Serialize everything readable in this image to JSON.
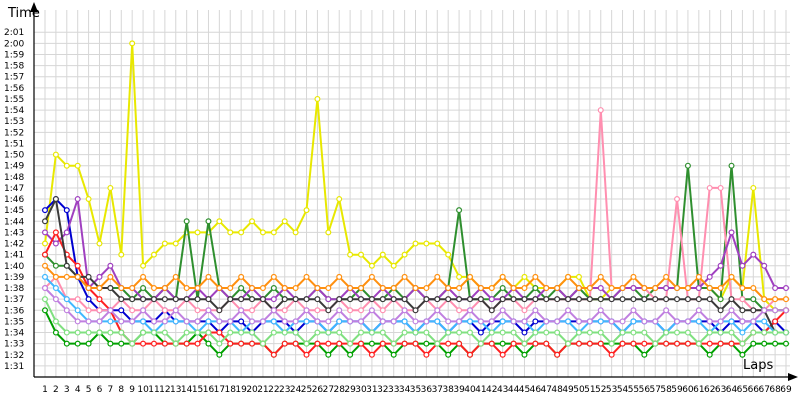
{
  "chart_data": {
    "type": "line",
    "title": "",
    "xlabel": "Laps",
    "ylabel": "Time",
    "grid": true,
    "legend": "none",
    "xlim": [
      1,
      69
    ],
    "ylim": [
      "1:30",
      "2:03"
    ],
    "x_ticks": [
      "1",
      "2",
      "3",
      "4",
      "5",
      "6",
      "7",
      "8",
      "9",
      "10",
      "11",
      "12",
      "13",
      "14",
      "15",
      "16",
      "17",
      "18",
      "19",
      "20",
      "21",
      "22",
      "23",
      "24",
      "25",
      "26",
      "27",
      "28",
      "29",
      "30",
      "31",
      "32",
      "33",
      "34",
      "35",
      "36",
      "37",
      "38",
      "39",
      "40",
      "41",
      "42",
      "43",
      "44",
      "45",
      "46",
      "47",
      "48",
      "49",
      "50",
      "51",
      "52",
      "53",
      "54",
      "55",
      "56",
      "57",
      "58",
      "59",
      "60",
      "61",
      "62",
      "63",
      "64",
      "65",
      "66",
      "67",
      "68",
      "69"
    ],
    "y_ticks": [
      "1:31",
      "1:32",
      "1:33",
      "1:34",
      "1:35",
      "1:36",
      "1:37",
      "1:38",
      "1:39",
      "1:40",
      "1:41",
      "1:42",
      "1:43",
      "1:44",
      "1:45",
      "1:46",
      "1:47",
      "1:48",
      "1:49",
      "1:50",
      "1:51",
      "1:52",
      "1:53",
      "1:54",
      "1:55",
      "1:56",
      "1:57",
      "1:58",
      "1:59",
      "2:00",
      "2:01"
    ],
    "series": [
      {
        "color": "#e8e800",
        "values": [
          "1:42",
          "1:50",
          "1:49",
          "1:49",
          "1:46",
          "1:42",
          "1:47",
          "1:41",
          "2:00",
          "1:40",
          "1:41",
          "1:42",
          "1:42",
          "1:43",
          "1:43",
          "1:43",
          "1:44",
          "1:43",
          "1:43",
          "1:44",
          "1:43",
          "1:43",
          "1:44",
          "1:43",
          "1:45",
          "1:55",
          "1:43",
          "1:46",
          "1:41",
          "1:41",
          "1:40",
          "1:41",
          "1:40",
          "1:41",
          "1:42",
          "1:42",
          "1:42",
          "1:41",
          "1:39",
          "1:39",
          "1:38",
          "1:38",
          "1:39",
          "1:38",
          "1:39",
          "1:38",
          "1:38",
          "1:38",
          "1:39",
          "1:39",
          "1:37",
          "1:37",
          "1:38",
          "1:38",
          "1:38",
          "1:38",
          "1:38",
          "1:38",
          "1:38",
          "1:38",
          "1:38",
          "1:38",
          "1:37",
          "1:39",
          "1:38",
          "1:47",
          "1:37",
          "1:36",
          "1:36"
        ]
      },
      {
        "color": "#00a000",
        "values": [
          "1:36",
          "1:34",
          "1:33",
          "1:33",
          "1:33",
          "1:34",
          "1:33",
          "1:33",
          "1:33",
          "1:34",
          "1:34",
          "1:33",
          "1:33",
          "1:33",
          "1:34",
          "1:33",
          "1:32",
          "1:33",
          "1:33",
          "1:33",
          "1:33",
          "1:32",
          "1:33",
          "1:33",
          "1:33",
          "1:33",
          "1:32",
          "1:33",
          "1:32",
          "1:33",
          "1:33",
          "1:33",
          "1:32",
          "1:33",
          "1:33",
          "1:33",
          "1:33",
          "1:32",
          "1:33",
          "1:32",
          "1:33",
          "1:33",
          "1:33",
          "1:33",
          "1:32",
          "1:33",
          "1:33",
          "1:32",
          "1:33",
          "1:33",
          "1:33",
          "1:33",
          "1:33",
          "1:33",
          "1:33",
          "1:32",
          "1:33",
          "1:33",
          "1:33",
          "1:33",
          "1:33",
          "1:32",
          "1:33",
          "1:33",
          "1:32",
          "1:33",
          "1:33",
          "1:33",
          "1:33"
        ]
      },
      {
        "color": "#2f8f2f",
        "values": [
          "1:41",
          "1:40",
          "1:40",
          "1:39",
          "1:38",
          "1:38",
          "1:38",
          "1:38",
          "1:37",
          "1:38",
          "1:37",
          "1:38",
          "1:37",
          "1:44",
          "1:37",
          "1:44",
          "1:38",
          "1:37",
          "1:38",
          "1:37",
          "1:37",
          "1:38",
          "1:37",
          "1:37",
          "1:37",
          "1:38",
          "1:37",
          "1:37",
          "1:37",
          "1:38",
          "1:37",
          "1:37",
          "1:38",
          "1:37",
          "1:38",
          "1:37",
          "1:37",
          "1:38",
          "1:45",
          "1:37",
          "1:37",
          "1:37",
          "1:38",
          "1:37",
          "1:37",
          "1:38",
          "1:37",
          "1:38",
          "1:37",
          "1:38",
          "1:37",
          "1:37",
          "1:37",
          "1:38",
          "1:38",
          "1:37",
          "1:38",
          "1:38",
          "1:38",
          "1:49",
          "1:38",
          "1:38",
          "1:37",
          "1:49",
          "1:37",
          "1:37",
          "1:36",
          "1:36",
          "1:36"
        ]
      },
      {
        "color": "#0000d0",
        "values": [
          "1:45",
          "1:46",
          "1:45",
          "1:39",
          "1:37",
          "1:36",
          "1:36",
          "1:36",
          "1:35",
          "1:35",
          "1:35",
          "1:36",
          "1:35",
          "1:35",
          "1:35",
          "1:35",
          "1:34",
          "1:35",
          "1:35",
          "1:34",
          "1:35",
          "1:35",
          "1:35",
          "1:34",
          "1:35",
          "1:35",
          "1:34",
          "1:35",
          "1:35",
          "1:35",
          "1:34",
          "1:35",
          "1:35",
          "1:35",
          "1:34",
          "1:35",
          "1:35",
          "1:34",
          "1:35",
          "1:35",
          "1:34",
          "1:35",
          "1:35",
          "1:35",
          "1:34",
          "1:35",
          "1:35",
          "1:35",
          "1:35",
          "1:35",
          "1:35",
          "1:35",
          "1:35",
          "1:34",
          "1:35",
          "1:35",
          "1:35",
          "1:34",
          "1:35",
          "1:35",
          "1:35",
          "1:35",
          "1:34",
          "1:35",
          "1:35",
          "1:35",
          "1:34",
          "1:35",
          "1:34"
        ]
      },
      {
        "color": "#ff8fb0",
        "values": [
          "1:38",
          "1:39",
          "1:37",
          "1:37",
          "1:36",
          "1:36",
          "1:36",
          "1:37",
          "1:36",
          "1:36",
          "1:37",
          "1:36",
          "1:36",
          "1:37",
          "1:36",
          "1:36",
          "1:36",
          "1:37",
          "1:36",
          "1:36",
          "1:37",
          "1:36",
          "1:36",
          "1:37",
          "1:36",
          "1:36",
          "1:36",
          "1:37",
          "1:36",
          "1:36",
          "1:37",
          "1:36",
          "1:37",
          "1:36",
          "1:36",
          "1:37",
          "1:36",
          "1:37",
          "1:36",
          "1:36",
          "1:37",
          "1:36",
          "1:37",
          "1:37",
          "1:36",
          "1:37",
          "1:37",
          "1:37",
          "1:37",
          "1:37",
          "1:37",
          "1:54",
          "1:38",
          "1:38",
          "1:38",
          "1:38",
          "1:37",
          "1:37",
          "1:46",
          "1:37",
          "1:37",
          "1:47",
          "1:47",
          "1:37",
          "1:37",
          "1:36",
          "1:36",
          "1:37",
          "1:37"
        ]
      },
      {
        "color": "#a040c0",
        "values": [
          "1:43",
          "1:42",
          "1:43",
          "1:46",
          "1:38",
          "1:39",
          "1:40",
          "1:38",
          "1:38",
          "1:37",
          "1:37",
          "1:38",
          "1:37",
          "1:37",
          "1:38",
          "1:37",
          "1:38",
          "1:37",
          "1:37",
          "1:38",
          "1:37",
          "1:37",
          "1:38",
          "1:37",
          "1:37",
          "1:38",
          "1:37",
          "1:37",
          "1:38",
          "1:37",
          "1:37",
          "1:38",
          "1:37",
          "1:37",
          "1:38",
          "1:37",
          "1:37",
          "1:38",
          "1:37",
          "1:37",
          "1:38",
          "1:37",
          "1:37",
          "1:38",
          "1:37",
          "1:37",
          "1:38",
          "1:38",
          "1:37",
          "1:38",
          "1:38",
          "1:38",
          "1:37",
          "1:38",
          "1:38",
          "1:38",
          "1:38",
          "1:38",
          "1:38",
          "1:38",
          "1:38",
          "1:39",
          "1:40",
          "1:43",
          "1:40",
          "1:41",
          "1:40",
          "1:38",
          "1:38"
        ]
      },
      {
        "color": "#ff2020",
        "values": [
          "1:41",
          "1:43",
          "1:41",
          "1:40",
          "1:38",
          "1:37",
          "1:36",
          "1:34",
          "1:33",
          "1:33",
          "1:33",
          "1:33",
          "1:33",
          "1:33",
          "1:33",
          "1:34",
          "1:34",
          "1:33",
          "1:33",
          "1:33",
          "1:33",
          "1:32",
          "1:33",
          "1:33",
          "1:32",
          "1:33",
          "1:33",
          "1:33",
          "1:33",
          "1:33",
          "1:32",
          "1:33",
          "1:33",
          "1:33",
          "1:33",
          "1:32",
          "1:33",
          "1:33",
          "1:33",
          "1:32",
          "1:33",
          "1:33",
          "1:32",
          "1:33",
          "1:33",
          "1:33",
          "1:33",
          "1:32",
          "1:33",
          "1:33",
          "1:33",
          "1:33",
          "1:32",
          "1:33",
          "1:33",
          "1:33",
          "1:33",
          "1:33",
          "1:33",
          "1:33",
          "1:33",
          "1:33",
          "1:33",
          "1:33",
          "1:33",
          "1:34",
          "1:34",
          "1:35",
          "1:36"
        ]
      },
      {
        "color": "#3a3a3a",
        "values": [
          "1:44",
          "1:46",
          "1:40",
          "1:39",
          "1:39",
          "1:38",
          "1:38",
          "1:37",
          "1:37",
          "1:37",
          "1:37",
          "1:37",
          "1:37",
          "1:37",
          "1:37",
          "1:37",
          "1:36",
          "1:37",
          "1:37",
          "1:37",
          "1:37",
          "1:36",
          "1:37",
          "1:37",
          "1:37",
          "1:37",
          "1:36",
          "1:37",
          "1:37",
          "1:37",
          "1:37",
          "1:37",
          "1:37",
          "1:37",
          "1:36",
          "1:37",
          "1:37",
          "1:37",
          "1:37",
          "1:37",
          "1:37",
          "1:36",
          "1:37",
          "1:37",
          "1:37",
          "1:37",
          "1:37",
          "1:37",
          "1:37",
          "1:37",
          "1:37",
          "1:37",
          "1:37",
          "1:37",
          "1:37",
          "1:37",
          "1:37",
          "1:37",
          "1:37",
          "1:37",
          "1:37",
          "1:37",
          "1:36",
          "1:37",
          "1:36",
          "1:36",
          "1:36",
          "1:34",
          "1:34"
        ]
      },
      {
        "color": "#40b8ff",
        "values": [
          "1:39",
          "1:38",
          "1:37",
          "1:36",
          "1:35",
          "1:35",
          "1:35",
          "1:35",
          "1:35",
          "1:35",
          "1:34",
          "1:35",
          "1:35",
          "1:35",
          "1:34",
          "1:35",
          "1:35",
          "1:35",
          "1:34",
          "1:35",
          "1:35",
          "1:35",
          "1:34",
          "1:35",
          "1:35",
          "1:35",
          "1:34",
          "1:35",
          "1:35",
          "1:35",
          "1:34",
          "1:35",
          "1:35",
          "1:35",
          "1:34",
          "1:35",
          "1:35",
          "1:34",
          "1:35",
          "1:35",
          "1:35",
          "1:34",
          "1:35",
          "1:35",
          "1:35",
          "1:34",
          "1:35",
          "1:35",
          "1:35",
          "1:34",
          "1:35",
          "1:35",
          "1:35",
          "1:34",
          "1:35",
          "1:35",
          "1:35",
          "1:34",
          "1:35",
          "1:35",
          "1:35",
          "1:34",
          "1:35",
          "1:35",
          "1:34",
          "1:35",
          "1:35",
          "1:34",
          "1:34"
        ]
      },
      {
        "color": "#80e080",
        "values": [
          "1:37",
          "1:35",
          "1:34",
          "1:34",
          "1:34",
          "1:34",
          "1:34",
          "1:34",
          "1:33",
          "1:34",
          "1:34",
          "1:34",
          "1:33",
          "1:34",
          "1:34",
          "1:34",
          "1:33",
          "1:34",
          "1:34",
          "1:34",
          "1:33",
          "1:34",
          "1:34",
          "1:34",
          "1:33",
          "1:34",
          "1:34",
          "1:34",
          "1:33",
          "1:34",
          "1:34",
          "1:34",
          "1:33",
          "1:34",
          "1:34",
          "1:34",
          "1:33",
          "1:34",
          "1:34",
          "1:34",
          "1:33",
          "1:34",
          "1:34",
          "1:34",
          "1:33",
          "1:34",
          "1:34",
          "1:34",
          "1:33",
          "1:34",
          "1:34",
          "1:34",
          "1:33",
          "1:34",
          "1:34",
          "1:34",
          "1:33",
          "1:34",
          "1:34",
          "1:34",
          "1:33",
          "1:34",
          "1:34",
          "1:34",
          "1:33",
          "1:34",
          "1:34",
          "1:34",
          "1:34"
        ]
      },
      {
        "color": "#ff9010",
        "values": [
          "1:40",
          "1:39",
          "1:39",
          "1:39",
          "1:38",
          "1:38",
          "1:39",
          "1:38",
          "1:38",
          "1:39",
          "1:38",
          "1:38",
          "1:39",
          "1:38",
          "1:38",
          "1:39",
          "1:38",
          "1:38",
          "1:39",
          "1:38",
          "1:38",
          "1:39",
          "1:38",
          "1:38",
          "1:39",
          "1:38",
          "1:38",
          "1:39",
          "1:38",
          "1:38",
          "1:39",
          "1:38",
          "1:38",
          "1:39",
          "1:38",
          "1:38",
          "1:39",
          "1:38",
          "1:38",
          "1:39",
          "1:38",
          "1:38",
          "1:39",
          "1:38",
          "1:38",
          "1:39",
          "1:38",
          "1:38",
          "1:39",
          "1:38",
          "1:38",
          "1:39",
          "1:38",
          "1:38",
          "1:39",
          "1:38",
          "1:38",
          "1:39",
          "1:38",
          "1:38",
          "1:39",
          "1:38",
          "1:38",
          "1:39",
          "1:38",
          "1:38",
          "1:37",
          "1:37",
          "1:37"
        ]
      },
      {
        "color": "#c080e0",
        "values": [
          "1:38",
          "1:37",
          "1:36",
          "1:35",
          "1:35",
          "1:35",
          "1:36",
          "1:35",
          "1:35",
          "1:36",
          "1:35",
          "1:35",
          "1:36",
          "1:35",
          "1:35",
          "1:36",
          "1:35",
          "1:35",
          "1:36",
          "1:35",
          "1:35",
          "1:36",
          "1:35",
          "1:35",
          "1:36",
          "1:35",
          "1:35",
          "1:36",
          "1:35",
          "1:35",
          "1:36",
          "1:35",
          "1:35",
          "1:36",
          "1:35",
          "1:35",
          "1:36",
          "1:35",
          "1:35",
          "1:36",
          "1:35",
          "1:35",
          "1:36",
          "1:35",
          "1:35",
          "1:36",
          "1:35",
          "1:35",
          "1:36",
          "1:35",
          "1:35",
          "1:36",
          "1:35",
          "1:35",
          "1:36",
          "1:35",
          "1:35",
          "1:36",
          "1:35",
          "1:35",
          "1:36",
          "1:35",
          "1:35",
          "1:36",
          "1:35",
          "1:35",
          "1:36",
          "1:36",
          "1:36"
        ]
      }
    ]
  }
}
